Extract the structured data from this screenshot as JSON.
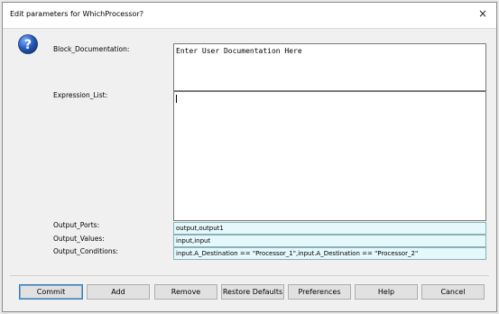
{
  "dialog": {
    "title": "Edit parameters for WhichProcessor?",
    "close_glyph": "×"
  },
  "fields": {
    "block_documentation": {
      "label": "Block_Documentation:",
      "value": "Enter User Documentation Here"
    },
    "expression_list": {
      "label": "Expression_List:",
      "value": ""
    },
    "output_ports": {
      "label": "Output_Ports:",
      "value": "output,output1"
    },
    "output_values": {
      "label": "Output_Values:",
      "value": "input,input"
    },
    "output_conditions": {
      "label": "Output_Conditions:",
      "value": "input.A_Destination == \"Processor_1\",input.A_Destination == \"Processor_2\""
    }
  },
  "buttons": {
    "commit": "Commit",
    "add": "Add",
    "remove": "Remove",
    "restore_defaults": "Restore Defaults",
    "preferences": "Preferences",
    "help": "Help",
    "cancel": "Cancel"
  },
  "icons": {
    "help": "question-mark-icon",
    "close": "close-icon"
  },
  "colors": {
    "help_icon": "#1f4fa8",
    "field_bg": "#e5f8fc",
    "default_button_border": "#3c7fb1"
  }
}
